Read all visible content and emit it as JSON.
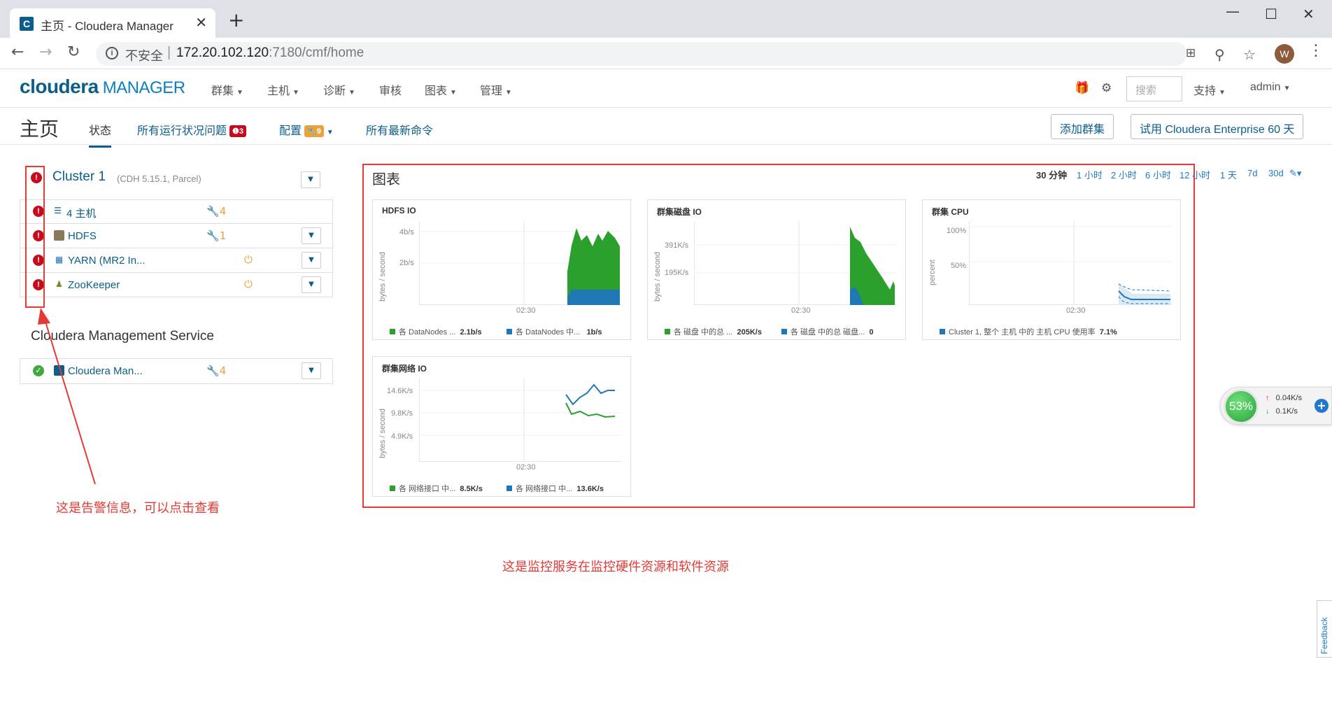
{
  "browser": {
    "tab_title": "主页 - Cloudera Manager",
    "tab_favicon": "C",
    "new_tab": "+",
    "security_text": "不安全",
    "url_host": "172.20.102.120",
    "url_rest": ":7180/cmf/home",
    "avatar": "W"
  },
  "app": {
    "logo_main": "cloudera",
    "logo_sub": "MANAGER",
    "menus": [
      "群集",
      "主机",
      "诊断",
      "审核",
      "图表",
      "管理"
    ],
    "search_placeholder": "搜索",
    "support": "支持",
    "user": "admin"
  },
  "subnav": {
    "title": "主页",
    "tabs": {
      "status": "状态",
      "issues": "所有运行状况问题",
      "issues_count": "3",
      "config": "配置",
      "config_count": "9",
      "commands": "所有最新命令"
    },
    "add_cluster": "添加群集",
    "trial": "试用 Cloudera Enterprise 60 天"
  },
  "cluster": {
    "name": "Cluster 1",
    "version": "(CDH 5.15.1, Parcel)",
    "rows": [
      {
        "name": "4 主机",
        "config_issues": "4"
      },
      {
        "name": "HDFS",
        "config_issues": "1"
      },
      {
        "name": "YARN (MR2 In..."
      },
      {
        "name": "ZooKeeper"
      }
    ]
  },
  "mgmt": {
    "title": "Cloudera Management Service",
    "row_name": "Cloudera Man...",
    "config_issues": "4"
  },
  "charts_panel": {
    "title": "图表",
    "ranges": [
      "30 分钟",
      "1 小时",
      "2 小时",
      "6 小时",
      "12 小时",
      "1 天",
      "7d",
      "30d"
    ],
    "active_range": "30 分钟"
  },
  "chart_data": [
    {
      "type": "area",
      "title": "HDFS IO",
      "ylabel": "bytes / second",
      "yticks": [
        "4b/s",
        "2b/s"
      ],
      "xticks": [
        "02:30"
      ],
      "series": [
        {
          "name": "各 DataNodes ...",
          "color": "#2ca02c",
          "value": "2.1b/s"
        },
        {
          "name": "各 DataNodes 中...",
          "color": "#1f77b4",
          "value": "1b/s"
        }
      ]
    },
    {
      "type": "area",
      "title": "群集磁盘 IO",
      "ylabel": "bytes / second",
      "yticks": [
        "391K/s",
        "195K/s"
      ],
      "xticks": [
        "02:30"
      ],
      "series": [
        {
          "name": "各 磁盘 中的总 ...",
          "color": "#2ca02c",
          "value": "205K/s"
        },
        {
          "name": "各 磁盘 中的总 磁盘...",
          "color": "#1f77b4",
          "value": "0"
        }
      ]
    },
    {
      "type": "line",
      "title": "群集 CPU",
      "ylabel": "percent",
      "yticks": [
        "100%",
        "50%"
      ],
      "xticks": [
        "02:30"
      ],
      "series": [
        {
          "name": "Cluster 1, 整个 主机 中的 主机 CPU 使用率",
          "color": "#1f77b4",
          "value": "7.1%"
        }
      ]
    },
    {
      "type": "line",
      "title": "群集网络 IO",
      "ylabel": "bytes / second",
      "yticks": [
        "14.6K/s",
        "9.8K/s",
        "4.9K/s"
      ],
      "xticks": [
        "02:30"
      ],
      "series": [
        {
          "name": "各 网络接口 中...",
          "color": "#2ca02c",
          "value": "8.5K/s"
        },
        {
          "name": "各 网络接口 中...",
          "color": "#1f77b4",
          "value": "13.6K/s"
        }
      ]
    }
  ],
  "widget": {
    "percent": "53%",
    "up": "0.04K/s",
    "down": "0.1K/s",
    "feedback": "Feedback"
  },
  "annotations": {
    "alert_note": "这是告警信息，可以点击查看",
    "monitor_note": "这是监控服务在监控硬件资源和软件资源"
  },
  "colors": {
    "brand": "#0b5d8c",
    "alarm": "#c50c1f",
    "green": "#2ca02c",
    "blue": "#1f77b4",
    "annotation": "#e53935"
  }
}
